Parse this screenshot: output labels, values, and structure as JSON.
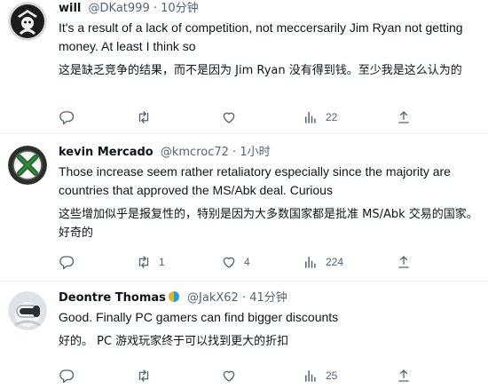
{
  "tweets": [
    {
      "name": "will",
      "handle": "@DKat999",
      "dot": "·",
      "time": "10分钟",
      "text_en": "It's a result of a lack of competition, not meccersarily Jim Ryan not getting money. At least I think so",
      "text_zh": "这是缺乏竞争的结果，而不是因为 Jim Ryan 没有得到钱。至少我是这么认为的",
      "reply_count": "",
      "retweet_count": "",
      "like_count": "",
      "views": "22"
    },
    {
      "name": "kevin Mercado",
      "handle": "@kmcroc72",
      "dot": "·",
      "time": "1小时",
      "text_en": "Those increase seem rather retaliatory especially since the majority are countries that approved the MS/Abk deal. Curious",
      "text_zh": "这些增加似乎是报复性的，特别是因为大多数国家都是批准 MS/Abk 交易的国家。好奇的",
      "reply_count": "",
      "retweet_count": "1",
      "like_count": "4",
      "views": "224"
    },
    {
      "name": "Deontre Thomas",
      "handle": "@JakX62",
      "dot": "·",
      "time": "41分钟",
      "text_en": "Good. Finally PC gamers can find bigger discounts",
      "text_zh": "好的。 PC 游戏玩家终于可以找到更大的折扣",
      "reply_count": "",
      "retweet_count": "",
      "like_count": "",
      "views": "25"
    }
  ],
  "icons": {
    "reply": "reply-icon",
    "retweet": "retweet-icon",
    "like": "like-icon",
    "views": "views-icon",
    "share": "share-icon",
    "verified": "verified-badge-icon"
  },
  "colors": {
    "text_primary": "#0f1419",
    "text_secondary": "#536471",
    "separator": "#eff3f4",
    "badge_gold": "#e2b719",
    "badge_blue": "#1d9bf0"
  }
}
